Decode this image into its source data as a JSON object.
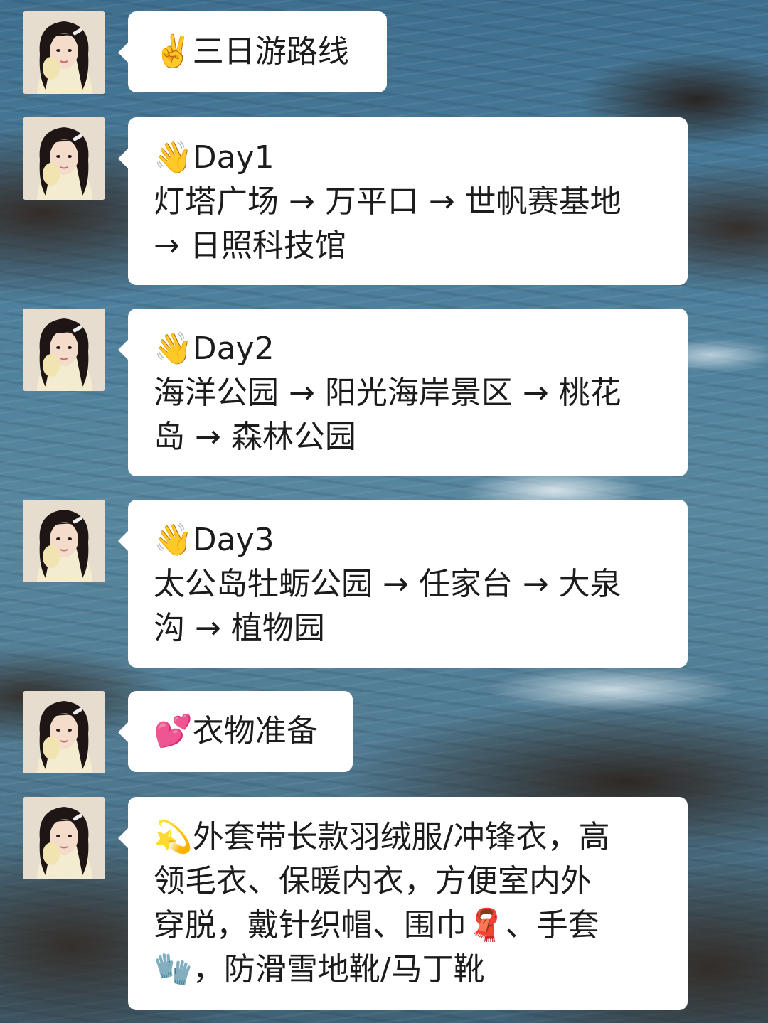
{
  "messages": [
    {
      "avatar_icon": "avatar-icon",
      "lines": [
        "✌️三日游路线"
      ]
    },
    {
      "avatar_icon": "avatar-icon",
      "lines": [
        "👋Day1",
        "灯塔广场 → 万平口 → 世帆赛基地",
        "→ 日照科技馆"
      ]
    },
    {
      "avatar_icon": "avatar-icon",
      "lines": [
        "👋Day2",
        "海洋公园 → 阳光海岸景区 → 桃花",
        "岛 → 森林公园"
      ]
    },
    {
      "avatar_icon": "avatar-icon",
      "lines": [
        "👋Day3",
        "太公岛牡蛎公园 → 任家台 → 大泉",
        "沟 → 植物园"
      ]
    },
    {
      "avatar_icon": "avatar-icon",
      "lines": [
        "💕衣物准备"
      ]
    },
    {
      "avatar_icon": "avatar-icon",
      "lines": [
        "💫外套带长款羽绒服/冲锋衣，高",
        "领毛衣、保暖内衣，方便室内外",
        "穿脱，戴针织帽、围巾🧣、手套",
        "🧤，防滑雪地靴/马丁靴"
      ]
    }
  ],
  "colors": {
    "bubble": "#ffffff",
    "text": "#1c1c1c",
    "sea": "#4b7d9b",
    "rock": "#3a2e28"
  }
}
